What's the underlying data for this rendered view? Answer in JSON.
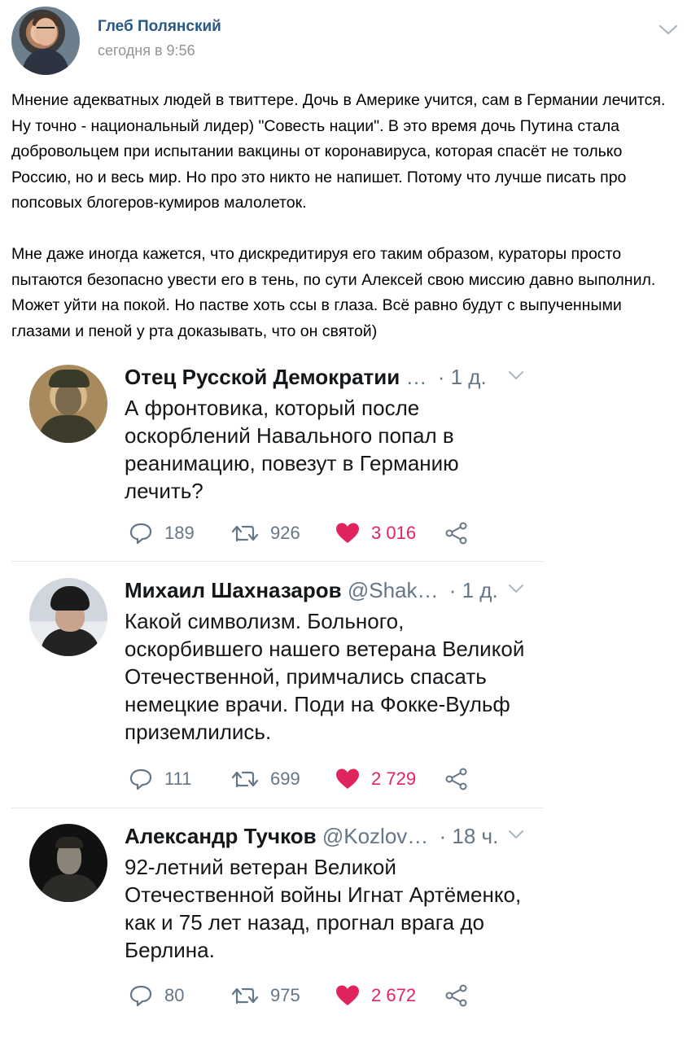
{
  "post": {
    "author": "Глеб Полянский",
    "time": "сегодня в 9:56",
    "paragraphs": [
      "Мнение адекватных людей в твиттере. Дочь в Америке учится, сам в Германии лечится. Ну точно - национальный лидер) \"Совесть нации\". В это время дочь Путина стала добровольцем при испытании вакцины от коронавируса, которая спасёт не только Россию, но и весь мир. Но про это никто не напишет. Потому что лучше писать про попсовых блогеров-кумиров малолеток.",
      "Мне даже иногда кажется, что дискредитируя его таким образом, кураторы просто пытаются безопасно увести его в тень, по сути Алексей свою миссию давно выполнил. Может уйти на покой. Но пастве хоть ссы в глаза. Всё равно будут с выпученными глазами и пеной у рта доказывать, что он святой)"
    ]
  },
  "tweets": [
    {
      "name": "Отец Русской Демократии",
      "handle": "…",
      "time": "· 1 д.",
      "text": "А фронтовика, который после оскорблений Навального попал в реанимацию, повезут в Германию лечить?",
      "replies": "189",
      "retweets": "926",
      "likes": "3 016"
    },
    {
      "name": "Михаил Шахназаров",
      "handle": "@Shak…",
      "time": "· 1 д.",
      "text": "Какой символизм. Больного, оскорбившего нашего ветерана Великой Отечественной, примчались спасать немецкие врачи. Поди на Фокке-Вульф приземлились.",
      "replies": "111",
      "retweets": "699",
      "likes": "2 729"
    },
    {
      "name": "Александр Тучков",
      "handle": "@Kozlov…",
      "time": "· 18 ч.",
      "text": "92-летний ветеран Великой Отечественной войны Игнат Артёменко, как и 75 лет назад, прогнал врага до Берлина.",
      "replies": "80",
      "retweets": "975",
      "likes": "2 672"
    }
  ],
  "colors": {
    "vk_link": "#2a5885",
    "vk_meta": "#939393",
    "twitter_meta": "#657786",
    "like_red": "#e0245e",
    "separator": "#e1e8ed"
  },
  "icons": [
    "chevron-down-icon",
    "reply-icon",
    "retweet-icon",
    "heart-icon",
    "share-icon"
  ]
}
